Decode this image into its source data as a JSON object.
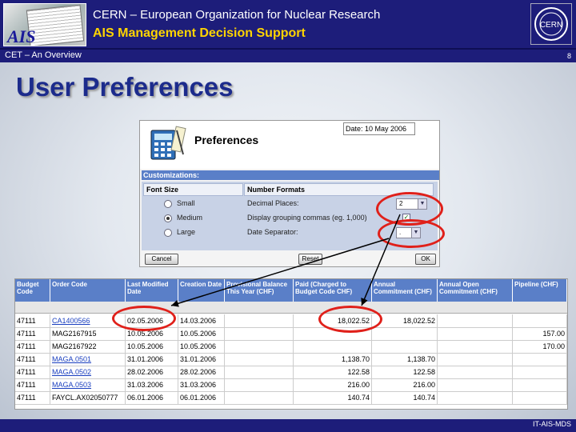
{
  "header": {
    "org_title": "CERN – European Organization for Nuclear Research",
    "subtitle": "AIS Management Decision Support",
    "logo_text": "AIS",
    "cern_logo_text": "CERN"
  },
  "subbar": {
    "section": "CET – An Overview",
    "page_number": "8"
  },
  "slide_title": "User Preferences",
  "preferences": {
    "title": "Preferences",
    "date": "Date: 10 May 2006",
    "customizations_label": "Customizations:",
    "font_size_header": "Font Size",
    "number_formats_header": "Number Formats",
    "font_options": [
      {
        "label": "Small",
        "selected": false
      },
      {
        "label": "Medium",
        "selected": true
      },
      {
        "label": "Large",
        "selected": false
      }
    ],
    "decimal_places_label": "Decimal Places:",
    "decimal_places_value": "2",
    "grouping_label": "Display grouping commas (eg. 1,000)",
    "grouping_checked": true,
    "separator_label": "Date Separator:",
    "separator_value": ".",
    "cancel_label": "Cancel",
    "reset_label": "Reset",
    "ok_label": "OK"
  },
  "table": {
    "columns": [
      "Budget Code",
      "Order Code",
      "Last Modified Date",
      "Creation Date",
      "Provisional Balance This Year (CHF)",
      "Paid (Charged to Budget Code CHF)",
      "Annual Commitment (CHF)",
      "Annual Open Commitment (CHF)",
      "Pipeline (CHF)"
    ],
    "rows": [
      {
        "budget": "47111",
        "order": "CA1400566",
        "order_link": true,
        "modified": "02.05.2006",
        "created": "14.03.2006",
        "balance": "",
        "paid": "18,022.52",
        "annual": "18,022.52",
        "open": "",
        "pipeline": ""
      },
      {
        "budget": "47111",
        "order": "MAG2167915",
        "order_link": false,
        "modified": "10.05.2006",
        "created": "10.05.2006",
        "balance": "",
        "paid": "",
        "annual": "",
        "open": "",
        "pipeline": "157.00"
      },
      {
        "budget": "47111",
        "order": "MAG2167922",
        "order_link": false,
        "modified": "10.05.2006",
        "created": "10.05.2006",
        "balance": "",
        "paid": "",
        "annual": "",
        "open": "",
        "pipeline": "170.00"
      },
      {
        "budget": "47111",
        "order": "MAGA.0501",
        "order_link": true,
        "modified": "31.01.2006",
        "created": "31.01.2006",
        "balance": "",
        "paid": "1,138.70",
        "annual": "1,138.70",
        "open": "",
        "pipeline": ""
      },
      {
        "budget": "47111",
        "order": "MAGA.0502",
        "order_link": true,
        "modified": "28.02.2006",
        "created": "28.02.2006",
        "balance": "",
        "paid": "122.58",
        "annual": "122.58",
        "open": "",
        "pipeline": ""
      },
      {
        "budget": "47111",
        "order": "MAGA.0503",
        "order_link": true,
        "modified": "31.03.2006",
        "created": "31.03.2006",
        "balance": "",
        "paid": "216.00",
        "annual": "216.00",
        "open": "",
        "pipeline": ""
      },
      {
        "budget": "47111",
        "order": "FAYCL.AX02050777",
        "order_link": false,
        "modified": "06.01.2006",
        "created": "06.01.2006",
        "balance": "",
        "paid": "140.74",
        "annual": "140.74",
        "open": "",
        "pipeline": ""
      }
    ]
  },
  "footer": {
    "text": "IT-AIS-MDS"
  },
  "colors": {
    "header_bg": "#1d1d7a",
    "subtitle": "#ffd400",
    "table_header": "#5a7fc8",
    "highlight": "#e0201a"
  }
}
